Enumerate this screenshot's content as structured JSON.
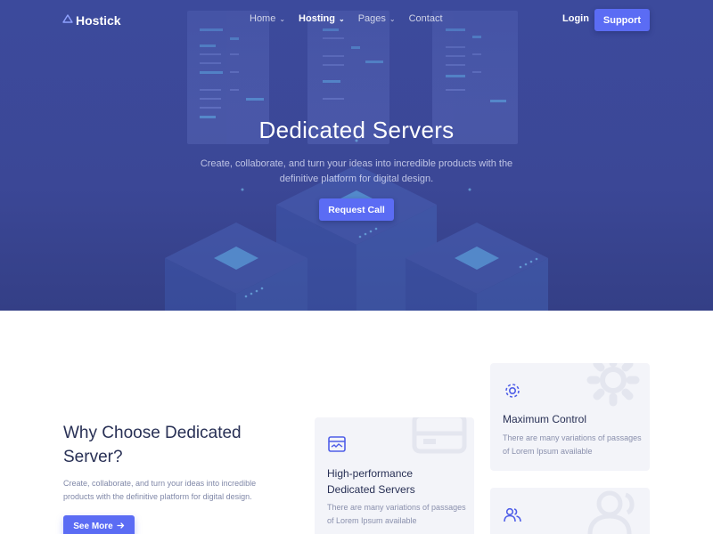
{
  "brand": {
    "name": "Hostick",
    "logo_icon": "cloud-icon"
  },
  "nav": {
    "items": [
      {
        "label": "Home",
        "has_dropdown": true,
        "active": false
      },
      {
        "label": "Hosting",
        "has_dropdown": true,
        "active": true
      },
      {
        "label": "Pages",
        "has_dropdown": true,
        "active": false
      },
      {
        "label": "Contact",
        "has_dropdown": false,
        "active": false
      }
    ],
    "login_label": "Login",
    "support_label": "Support"
  },
  "hero": {
    "title": "Dedicated Servers",
    "subtitle": "Create, collaborate, and turn your ideas into incredible products with the definitive platform for digital design.",
    "cta_label": "Request Call"
  },
  "why": {
    "title": "Why Choose Dedicated Server?",
    "description": "Create, collaborate, and turn your ideas into incredible products with the definitive platform for digital design.",
    "button_label": "See More",
    "button_icon": "arrow-right-icon"
  },
  "features": [
    {
      "icon": "monitor-icon",
      "title": "High-performance Dedicated Servers",
      "text": "There are many variations of passages of Lorem Ipsum available"
    },
    {
      "icon": "gear-icon",
      "title": "Maximum Control",
      "text": "There are many variations of passages of Lorem Ipsum available"
    },
    {
      "icon": "users-icon",
      "title": "",
      "text": ""
    }
  ],
  "colors": {
    "hero_bg": "#3b4796",
    "accent": "#5b6cf4",
    "heading": "#283055",
    "card_bg": "#f3f4f9"
  }
}
